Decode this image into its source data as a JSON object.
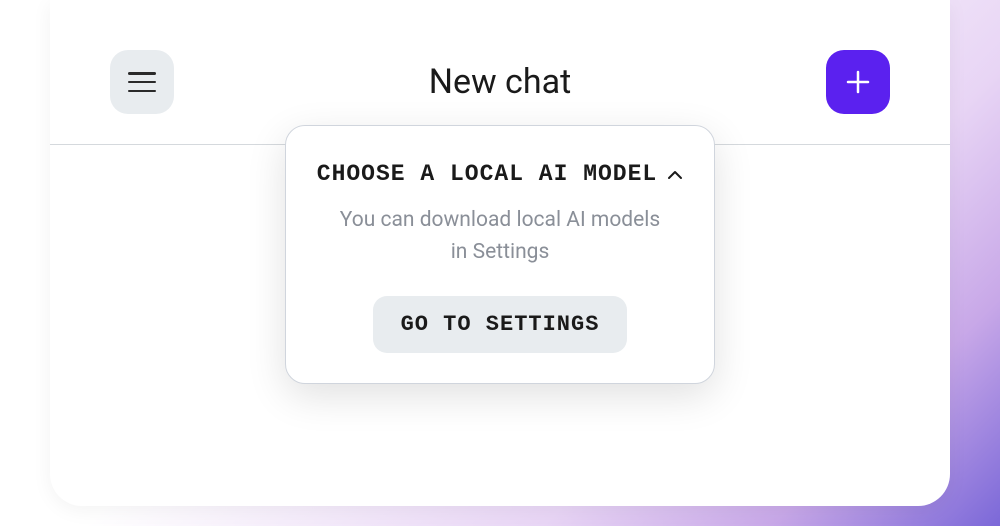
{
  "header": {
    "title": "New chat"
  },
  "popover": {
    "title": "CHOOSE A LOCAL AI MODEL",
    "description": "You can download local AI models in Settings",
    "button_label": "GO TO SETTINGS"
  }
}
